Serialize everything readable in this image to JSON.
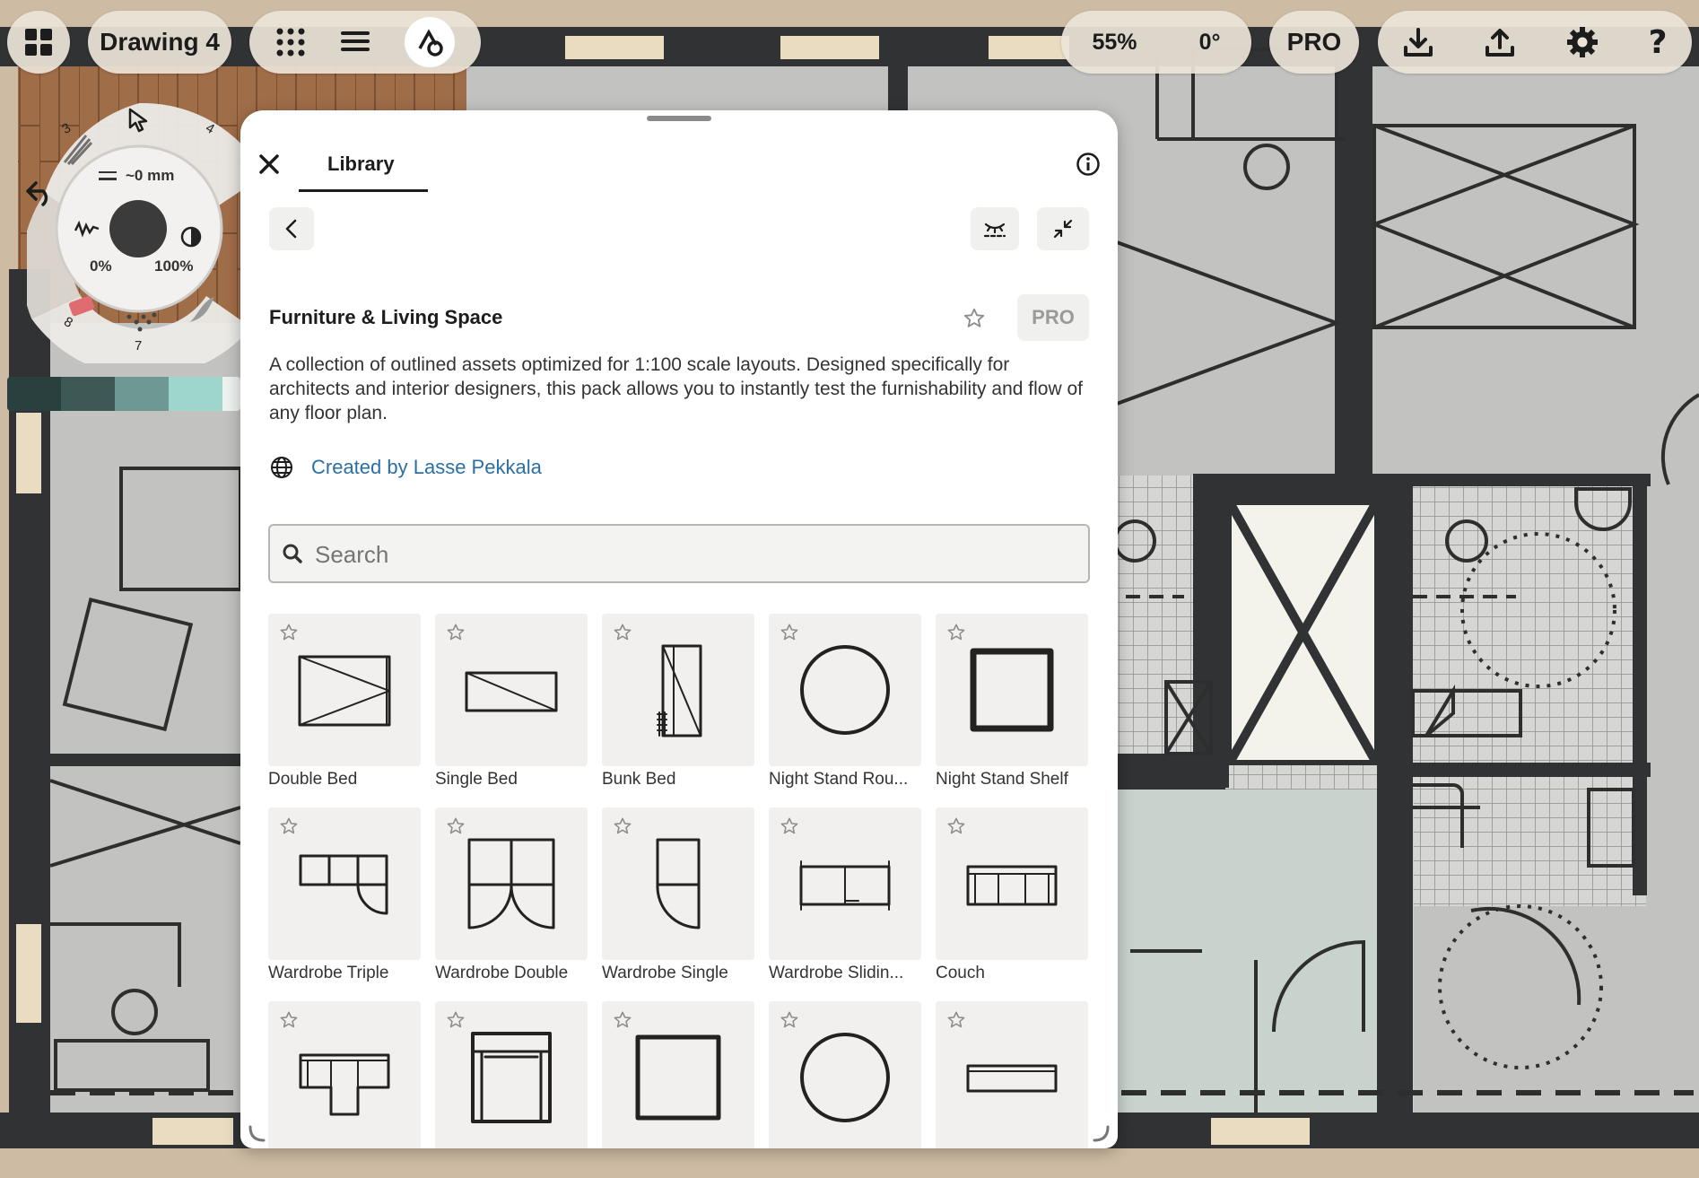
{
  "toolbar": {
    "drawing_title": "Drawing 4",
    "zoom": "55%",
    "rotation": "0°",
    "pro_label": "PRO"
  },
  "tool_wheel": {
    "size_label": "~0 mm",
    "opacity_min": "0%",
    "opacity_max": "100%",
    "slot_3": "3",
    "slot_4": "4",
    "slot_8": "8",
    "slot_7": "7"
  },
  "palette": [
    "#29403f",
    "#3d5956",
    "#6e9993",
    "#9fd6cb",
    "#eef2f0"
  ],
  "library": {
    "tab": "Library",
    "pack_title": "Furniture & Living Space",
    "pro_badge": "PRO",
    "description": "A collection of outlined assets optimized for 1:100 scale layouts. Designed specifically for architects and interior designers, this pack allows you to instantly test the furnishability and flow of any floor plan.",
    "creator_link": "Created by Lasse Pekkala",
    "search_placeholder": "Search",
    "items": [
      {
        "label": "Double Bed",
        "icon": "double-bed"
      },
      {
        "label": "Single Bed",
        "icon": "single-bed"
      },
      {
        "label": "Bunk Bed",
        "icon": "bunk-bed"
      },
      {
        "label": "Night Stand Rou...",
        "icon": "night-stand-round"
      },
      {
        "label": "Night Stand Shelf",
        "icon": "night-stand-shelf"
      },
      {
        "label": "Wardrobe Triple",
        "icon": "wardrobe-triple"
      },
      {
        "label": "Wardrobe Double",
        "icon": "wardrobe-double"
      },
      {
        "label": "Wardrobe Single",
        "icon": "wardrobe-single"
      },
      {
        "label": "Wardrobe Slidin...",
        "icon": "wardrobe-sliding"
      },
      {
        "label": "Couch",
        "icon": "couch"
      },
      {
        "label": "",
        "icon": "corner-sofa"
      },
      {
        "label": "",
        "icon": "armchair"
      },
      {
        "label": "",
        "icon": "square-table"
      },
      {
        "label": "",
        "icon": "round-table"
      },
      {
        "label": "",
        "icon": "tv-bench"
      }
    ]
  },
  "colors": {
    "accent_link": "#2a6fa6",
    "wall": "#303132",
    "floor_wood": "#a26f4b",
    "floor_tile": "#c7c7c5"
  }
}
